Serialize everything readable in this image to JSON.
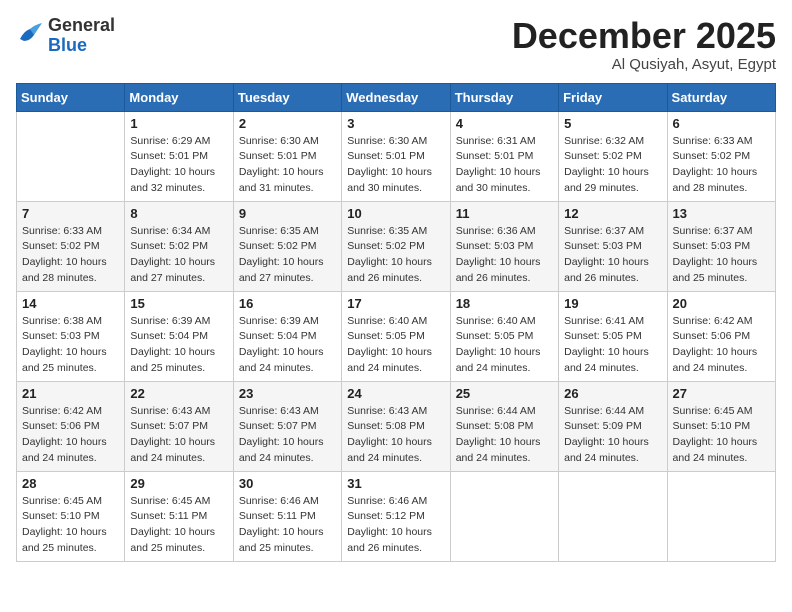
{
  "header": {
    "logo": {
      "general": "General",
      "blue": "Blue"
    },
    "month": "December 2025",
    "location": "Al Qusiyah, Asyut, Egypt"
  },
  "weekdays": [
    "Sunday",
    "Monday",
    "Tuesday",
    "Wednesday",
    "Thursday",
    "Friday",
    "Saturday"
  ],
  "weeks": [
    [
      {
        "day": "",
        "sunrise": "",
        "sunset": "",
        "daylight": ""
      },
      {
        "day": "1",
        "sunrise": "Sunrise: 6:29 AM",
        "sunset": "Sunset: 5:01 PM",
        "daylight": "Daylight: 10 hours and 32 minutes."
      },
      {
        "day": "2",
        "sunrise": "Sunrise: 6:30 AM",
        "sunset": "Sunset: 5:01 PM",
        "daylight": "Daylight: 10 hours and 31 minutes."
      },
      {
        "day": "3",
        "sunrise": "Sunrise: 6:30 AM",
        "sunset": "Sunset: 5:01 PM",
        "daylight": "Daylight: 10 hours and 30 minutes."
      },
      {
        "day": "4",
        "sunrise": "Sunrise: 6:31 AM",
        "sunset": "Sunset: 5:01 PM",
        "daylight": "Daylight: 10 hours and 30 minutes."
      },
      {
        "day": "5",
        "sunrise": "Sunrise: 6:32 AM",
        "sunset": "Sunset: 5:02 PM",
        "daylight": "Daylight: 10 hours and 29 minutes."
      },
      {
        "day": "6",
        "sunrise": "Sunrise: 6:33 AM",
        "sunset": "Sunset: 5:02 PM",
        "daylight": "Daylight: 10 hours and 28 minutes."
      }
    ],
    [
      {
        "day": "7",
        "sunrise": "Sunrise: 6:33 AM",
        "sunset": "Sunset: 5:02 PM",
        "daylight": "Daylight: 10 hours and 28 minutes."
      },
      {
        "day": "8",
        "sunrise": "Sunrise: 6:34 AM",
        "sunset": "Sunset: 5:02 PM",
        "daylight": "Daylight: 10 hours and 27 minutes."
      },
      {
        "day": "9",
        "sunrise": "Sunrise: 6:35 AM",
        "sunset": "Sunset: 5:02 PM",
        "daylight": "Daylight: 10 hours and 27 minutes."
      },
      {
        "day": "10",
        "sunrise": "Sunrise: 6:35 AM",
        "sunset": "Sunset: 5:02 PM",
        "daylight": "Daylight: 10 hours and 26 minutes."
      },
      {
        "day": "11",
        "sunrise": "Sunrise: 6:36 AM",
        "sunset": "Sunset: 5:03 PM",
        "daylight": "Daylight: 10 hours and 26 minutes."
      },
      {
        "day": "12",
        "sunrise": "Sunrise: 6:37 AM",
        "sunset": "Sunset: 5:03 PM",
        "daylight": "Daylight: 10 hours and 26 minutes."
      },
      {
        "day": "13",
        "sunrise": "Sunrise: 6:37 AM",
        "sunset": "Sunset: 5:03 PM",
        "daylight": "Daylight: 10 hours and 25 minutes."
      }
    ],
    [
      {
        "day": "14",
        "sunrise": "Sunrise: 6:38 AM",
        "sunset": "Sunset: 5:03 PM",
        "daylight": "Daylight: 10 hours and 25 minutes."
      },
      {
        "day": "15",
        "sunrise": "Sunrise: 6:39 AM",
        "sunset": "Sunset: 5:04 PM",
        "daylight": "Daylight: 10 hours and 25 minutes."
      },
      {
        "day": "16",
        "sunrise": "Sunrise: 6:39 AM",
        "sunset": "Sunset: 5:04 PM",
        "daylight": "Daylight: 10 hours and 24 minutes."
      },
      {
        "day": "17",
        "sunrise": "Sunrise: 6:40 AM",
        "sunset": "Sunset: 5:05 PM",
        "daylight": "Daylight: 10 hours and 24 minutes."
      },
      {
        "day": "18",
        "sunrise": "Sunrise: 6:40 AM",
        "sunset": "Sunset: 5:05 PM",
        "daylight": "Daylight: 10 hours and 24 minutes."
      },
      {
        "day": "19",
        "sunrise": "Sunrise: 6:41 AM",
        "sunset": "Sunset: 5:05 PM",
        "daylight": "Daylight: 10 hours and 24 minutes."
      },
      {
        "day": "20",
        "sunrise": "Sunrise: 6:42 AM",
        "sunset": "Sunset: 5:06 PM",
        "daylight": "Daylight: 10 hours and 24 minutes."
      }
    ],
    [
      {
        "day": "21",
        "sunrise": "Sunrise: 6:42 AM",
        "sunset": "Sunset: 5:06 PM",
        "daylight": "Daylight: 10 hours and 24 minutes."
      },
      {
        "day": "22",
        "sunrise": "Sunrise: 6:43 AM",
        "sunset": "Sunset: 5:07 PM",
        "daylight": "Daylight: 10 hours and 24 minutes."
      },
      {
        "day": "23",
        "sunrise": "Sunrise: 6:43 AM",
        "sunset": "Sunset: 5:07 PM",
        "daylight": "Daylight: 10 hours and 24 minutes."
      },
      {
        "day": "24",
        "sunrise": "Sunrise: 6:43 AM",
        "sunset": "Sunset: 5:08 PM",
        "daylight": "Daylight: 10 hours and 24 minutes."
      },
      {
        "day": "25",
        "sunrise": "Sunrise: 6:44 AM",
        "sunset": "Sunset: 5:08 PM",
        "daylight": "Daylight: 10 hours and 24 minutes."
      },
      {
        "day": "26",
        "sunrise": "Sunrise: 6:44 AM",
        "sunset": "Sunset: 5:09 PM",
        "daylight": "Daylight: 10 hours and 24 minutes."
      },
      {
        "day": "27",
        "sunrise": "Sunrise: 6:45 AM",
        "sunset": "Sunset: 5:10 PM",
        "daylight": "Daylight: 10 hours and 24 minutes."
      }
    ],
    [
      {
        "day": "28",
        "sunrise": "Sunrise: 6:45 AM",
        "sunset": "Sunset: 5:10 PM",
        "daylight": "Daylight: 10 hours and 25 minutes."
      },
      {
        "day": "29",
        "sunrise": "Sunrise: 6:45 AM",
        "sunset": "Sunset: 5:11 PM",
        "daylight": "Daylight: 10 hours and 25 minutes."
      },
      {
        "day": "30",
        "sunrise": "Sunrise: 6:46 AM",
        "sunset": "Sunset: 5:11 PM",
        "daylight": "Daylight: 10 hours and 25 minutes."
      },
      {
        "day": "31",
        "sunrise": "Sunrise: 6:46 AM",
        "sunset": "Sunset: 5:12 PM",
        "daylight": "Daylight: 10 hours and 26 minutes."
      },
      {
        "day": "",
        "sunrise": "",
        "sunset": "",
        "daylight": ""
      },
      {
        "day": "",
        "sunrise": "",
        "sunset": "",
        "daylight": ""
      },
      {
        "day": "",
        "sunrise": "",
        "sunset": "",
        "daylight": ""
      }
    ]
  ]
}
